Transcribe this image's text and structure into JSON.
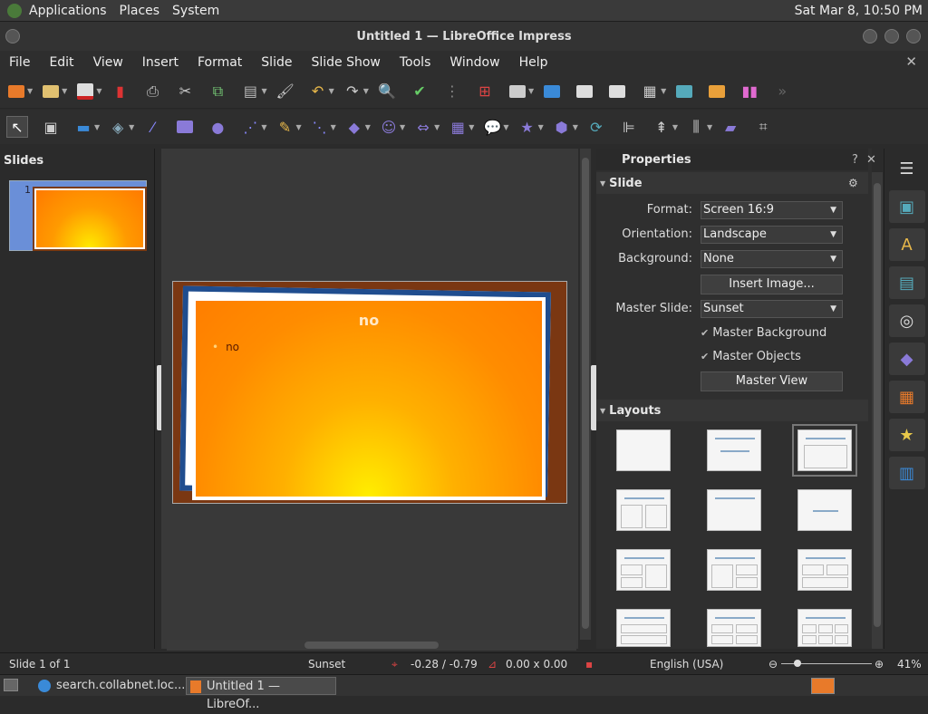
{
  "topbar": {
    "menus": [
      "Applications",
      "Places",
      "System"
    ],
    "clock": "Sat Mar  8, 10:50 PM"
  },
  "window": {
    "title": "Untitled 1 — LibreOffice Impress"
  },
  "menubar": {
    "items": [
      "File",
      "Edit",
      "View",
      "Insert",
      "Format",
      "Slide",
      "Slide Show",
      "Tools",
      "Window",
      "Help"
    ],
    "close": "✕"
  },
  "slides_pane": {
    "title": "Slides",
    "thumb_number": "1"
  },
  "slide": {
    "title": "no",
    "bullet": "no"
  },
  "properties": {
    "title": "Properties",
    "help": "?",
    "close": "✕",
    "slide_section": "Slide",
    "format_label": "Format:",
    "format_value": "Screen 16:9",
    "orientation_label": "Orientation:",
    "orientation_value": "Landscape",
    "background_label": "Background:",
    "background_value": "None",
    "insert_image": "Insert Image...",
    "master_slide_label": "Master Slide:",
    "master_slide_value": "Sunset",
    "master_background": "Master Background",
    "master_objects": "Master Objects",
    "master_view": "Master View",
    "layouts_section": "Layouts"
  },
  "statusbar": {
    "slide": "Slide 1 of 1",
    "master": "Sunset",
    "position": "-0.28 / -0.79",
    "size": "0.00 x 0.00",
    "language": "English (USA)",
    "zoom": "41%"
  },
  "taskbar": {
    "task1": "search.collabnet.loc...",
    "task2": "Untitled 1 — LibreOf..."
  },
  "colors": {
    "accent_blue": "#1f4d8f",
    "slide_orange": "#ff8c00",
    "slide_yellow": "#ffee00",
    "slide_border": "#7a3712"
  }
}
